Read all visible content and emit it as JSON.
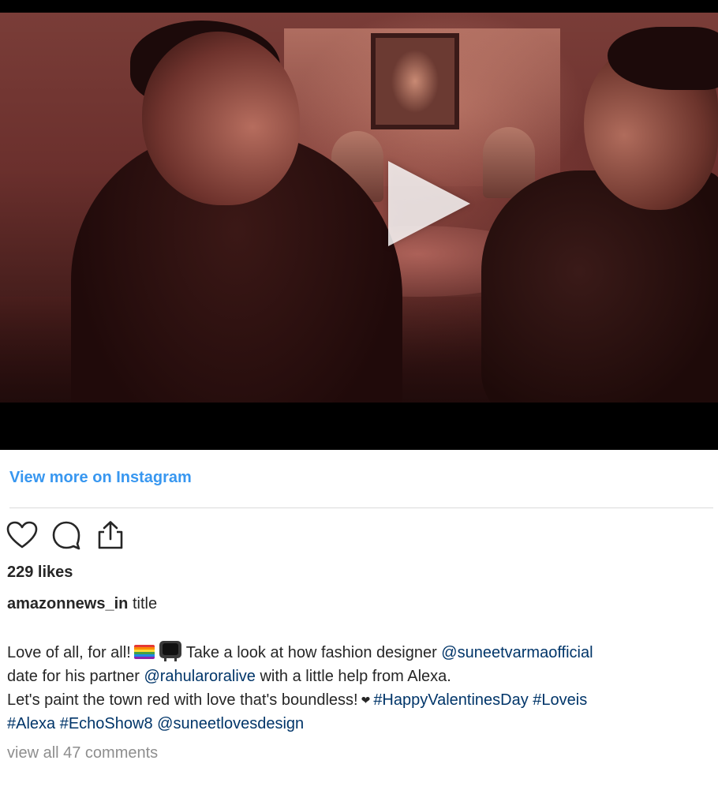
{
  "post": {
    "view_more_label": "View more on Instagram",
    "likes_text": "229 likes",
    "author": "amazonnews_in",
    "author_suffix": "title",
    "view_comments_label": "view all 47 comments"
  },
  "caption": {
    "line1_start": "Love of all, for all!",
    "line1_middle": "Take a look at how fashion designer",
    "mention_1": "@suneetvarmaofficial",
    "line2_start": "date for his partner",
    "mention_2": "@rahularoralive",
    "line2_end": "with a little help from Alexa.",
    "line3_start": "Let's paint the town red with love that's boundless!",
    "hashtag_1": "#HappyValentinesDay",
    "hashtag_2": "#Loveis",
    "hashtag_3": "#Alexa",
    "hashtag_4": "#EchoShow8",
    "mention_3": "@suneetlovesdesign"
  },
  "icons": {
    "heart": "heart-icon",
    "comment": "comment-icon",
    "share": "share-icon",
    "play": "play-icon",
    "rainbow_flag": "rainbow-flag-emoji",
    "tv": "television-emoji",
    "small_heart": "heart-emoji"
  },
  "colors": {
    "link_blue": "#3897f0",
    "mention_blue": "#003569",
    "text": "#262626",
    "muted": "#8e8e8e",
    "divider": "#dbdbdb"
  }
}
